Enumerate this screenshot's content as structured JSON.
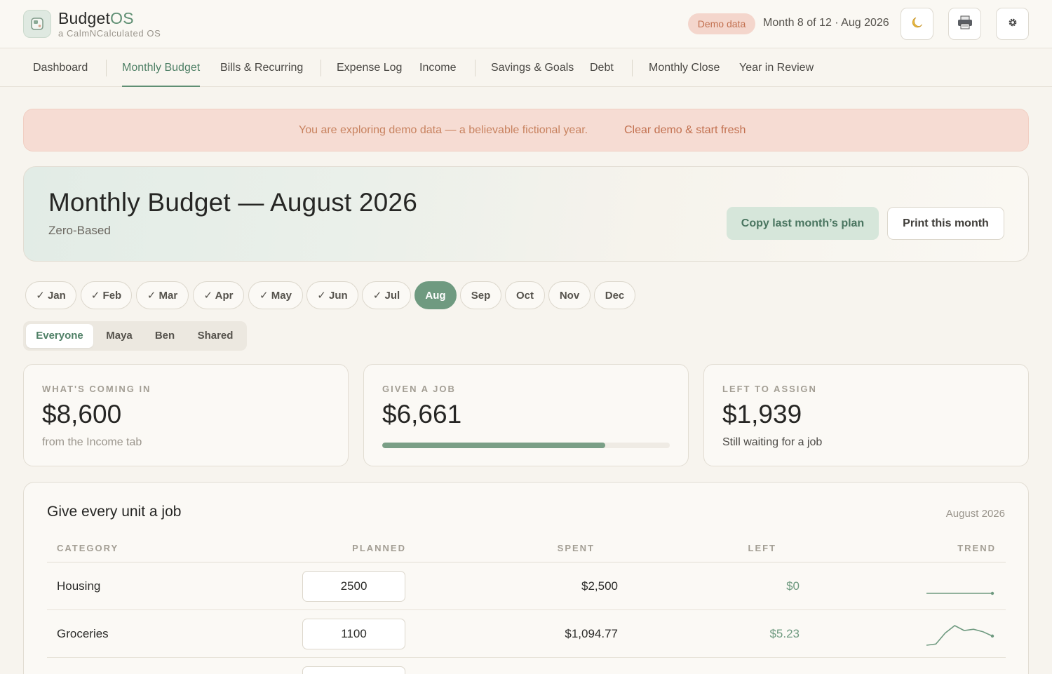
{
  "app": {
    "brand_main": "Budget",
    "brand_accent": "OS",
    "subtitle": "a CalmNCalculated OS",
    "demo_badge": "Demo data",
    "month_status": "Month 8 of 12 · Aug 2026",
    "theme_icon": "moon-icon",
    "print_icon": "printer-icon",
    "settings_icon": "gear-icon"
  },
  "nav": {
    "items": [
      "Dashboard",
      "Monthly Budget",
      "Bills & Recurring",
      "Expense Log",
      "Income",
      "Savings & Goals",
      "Debt",
      "Monthly Close",
      "Year in Review"
    ],
    "active": "Monthly Budget"
  },
  "banner": {
    "text": "You are exploring demo data — a believable fictional year.",
    "link": "Clear demo & start fresh"
  },
  "hero": {
    "title": "Monthly Budget — August 2026",
    "subtitle": "Zero-Based",
    "copy_button": "Copy last month’s plan",
    "print_button": "Print this month"
  },
  "months": [
    "✓ Jan",
    "✓ Feb",
    "✓ Mar",
    "✓ Apr",
    "✓ May",
    "✓ Jun",
    "✓ Jul",
    "Aug",
    "Sep",
    "Oct",
    "Nov",
    "Dec"
  ],
  "active_month": "Aug",
  "people": {
    "options": [
      "Everyone",
      "Maya",
      "Ben",
      "Shared"
    ],
    "active": "Everyone"
  },
  "stats": {
    "coming_in": {
      "label": "WHAT'S COMING IN",
      "value": "$8,600",
      "note": "from the Income tab"
    },
    "given_job": {
      "label": "GIVEN A JOB",
      "value": "$6,661",
      "progress": 0.7746
    },
    "left_assign": {
      "label": "LEFT TO ASSIGN",
      "value": "$1,939",
      "note": "Still waiting for a job"
    }
  },
  "table": {
    "title": "Give every unit a job",
    "month": "August 2026",
    "columns": {
      "category": "CATEGORY",
      "planned": "PLANNED",
      "spent": "SPENT",
      "left": "LEFT",
      "trend": "TREND"
    },
    "rows": [
      {
        "category": "Housing",
        "planned": "2500",
        "spent": "$2,500",
        "left": "$0",
        "trend": [
          2500,
          2500,
          2500,
          2500,
          2500,
          2500,
          2500,
          2500
        ]
      },
      {
        "category": "Groceries",
        "planned": "1100",
        "spent": "$1,094.77",
        "left": "$5.23",
        "trend": [
          1020,
          1030,
          1120,
          1180,
          1140,
          1150,
          1130,
          1095
        ]
      }
    ],
    "accent_color": "#6f9a80"
  }
}
